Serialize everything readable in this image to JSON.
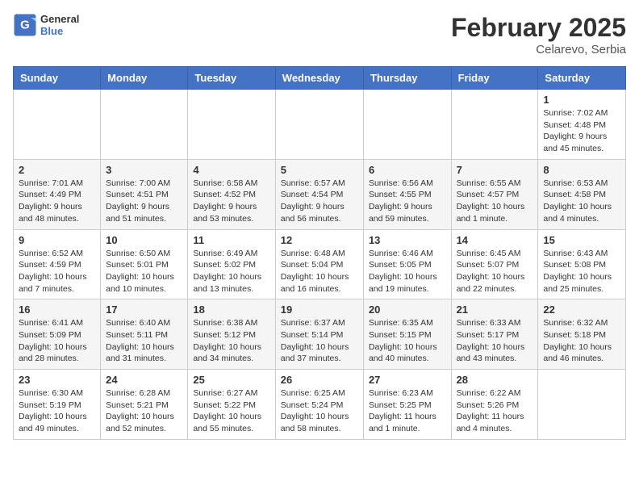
{
  "header": {
    "logo_general": "General",
    "logo_blue": "Blue",
    "month_title": "February 2025",
    "location": "Celarevo, Serbia"
  },
  "weekdays": [
    "Sunday",
    "Monday",
    "Tuesday",
    "Wednesday",
    "Thursday",
    "Friday",
    "Saturday"
  ],
  "weeks": [
    [
      {
        "day": "",
        "info": ""
      },
      {
        "day": "",
        "info": ""
      },
      {
        "day": "",
        "info": ""
      },
      {
        "day": "",
        "info": ""
      },
      {
        "day": "",
        "info": ""
      },
      {
        "day": "",
        "info": ""
      },
      {
        "day": "1",
        "info": "Sunrise: 7:02 AM\nSunset: 4:48 PM\nDaylight: 9 hours and 45 minutes."
      }
    ],
    [
      {
        "day": "2",
        "info": "Sunrise: 7:01 AM\nSunset: 4:49 PM\nDaylight: 9 hours and 48 minutes."
      },
      {
        "day": "3",
        "info": "Sunrise: 7:00 AM\nSunset: 4:51 PM\nDaylight: 9 hours and 51 minutes."
      },
      {
        "day": "4",
        "info": "Sunrise: 6:58 AM\nSunset: 4:52 PM\nDaylight: 9 hours and 53 minutes."
      },
      {
        "day": "5",
        "info": "Sunrise: 6:57 AM\nSunset: 4:54 PM\nDaylight: 9 hours and 56 minutes."
      },
      {
        "day": "6",
        "info": "Sunrise: 6:56 AM\nSunset: 4:55 PM\nDaylight: 9 hours and 59 minutes."
      },
      {
        "day": "7",
        "info": "Sunrise: 6:55 AM\nSunset: 4:57 PM\nDaylight: 10 hours and 1 minute."
      },
      {
        "day": "8",
        "info": "Sunrise: 6:53 AM\nSunset: 4:58 PM\nDaylight: 10 hours and 4 minutes."
      }
    ],
    [
      {
        "day": "9",
        "info": "Sunrise: 6:52 AM\nSunset: 4:59 PM\nDaylight: 10 hours and 7 minutes."
      },
      {
        "day": "10",
        "info": "Sunrise: 6:50 AM\nSunset: 5:01 PM\nDaylight: 10 hours and 10 minutes."
      },
      {
        "day": "11",
        "info": "Sunrise: 6:49 AM\nSunset: 5:02 PM\nDaylight: 10 hours and 13 minutes."
      },
      {
        "day": "12",
        "info": "Sunrise: 6:48 AM\nSunset: 5:04 PM\nDaylight: 10 hours and 16 minutes."
      },
      {
        "day": "13",
        "info": "Sunrise: 6:46 AM\nSunset: 5:05 PM\nDaylight: 10 hours and 19 minutes."
      },
      {
        "day": "14",
        "info": "Sunrise: 6:45 AM\nSunset: 5:07 PM\nDaylight: 10 hours and 22 minutes."
      },
      {
        "day": "15",
        "info": "Sunrise: 6:43 AM\nSunset: 5:08 PM\nDaylight: 10 hours and 25 minutes."
      }
    ],
    [
      {
        "day": "16",
        "info": "Sunrise: 6:41 AM\nSunset: 5:09 PM\nDaylight: 10 hours and 28 minutes."
      },
      {
        "day": "17",
        "info": "Sunrise: 6:40 AM\nSunset: 5:11 PM\nDaylight: 10 hours and 31 minutes."
      },
      {
        "day": "18",
        "info": "Sunrise: 6:38 AM\nSunset: 5:12 PM\nDaylight: 10 hours and 34 minutes."
      },
      {
        "day": "19",
        "info": "Sunrise: 6:37 AM\nSunset: 5:14 PM\nDaylight: 10 hours and 37 minutes."
      },
      {
        "day": "20",
        "info": "Sunrise: 6:35 AM\nSunset: 5:15 PM\nDaylight: 10 hours and 40 minutes."
      },
      {
        "day": "21",
        "info": "Sunrise: 6:33 AM\nSunset: 5:17 PM\nDaylight: 10 hours and 43 minutes."
      },
      {
        "day": "22",
        "info": "Sunrise: 6:32 AM\nSunset: 5:18 PM\nDaylight: 10 hours and 46 minutes."
      }
    ],
    [
      {
        "day": "23",
        "info": "Sunrise: 6:30 AM\nSunset: 5:19 PM\nDaylight: 10 hours and 49 minutes."
      },
      {
        "day": "24",
        "info": "Sunrise: 6:28 AM\nSunset: 5:21 PM\nDaylight: 10 hours and 52 minutes."
      },
      {
        "day": "25",
        "info": "Sunrise: 6:27 AM\nSunset: 5:22 PM\nDaylight: 10 hours and 55 minutes."
      },
      {
        "day": "26",
        "info": "Sunrise: 6:25 AM\nSunset: 5:24 PM\nDaylight: 10 hours and 58 minutes."
      },
      {
        "day": "27",
        "info": "Sunrise: 6:23 AM\nSunset: 5:25 PM\nDaylight: 11 hours and 1 minute."
      },
      {
        "day": "28",
        "info": "Sunrise: 6:22 AM\nSunset: 5:26 PM\nDaylight: 11 hours and 4 minutes."
      },
      {
        "day": "",
        "info": ""
      }
    ]
  ]
}
